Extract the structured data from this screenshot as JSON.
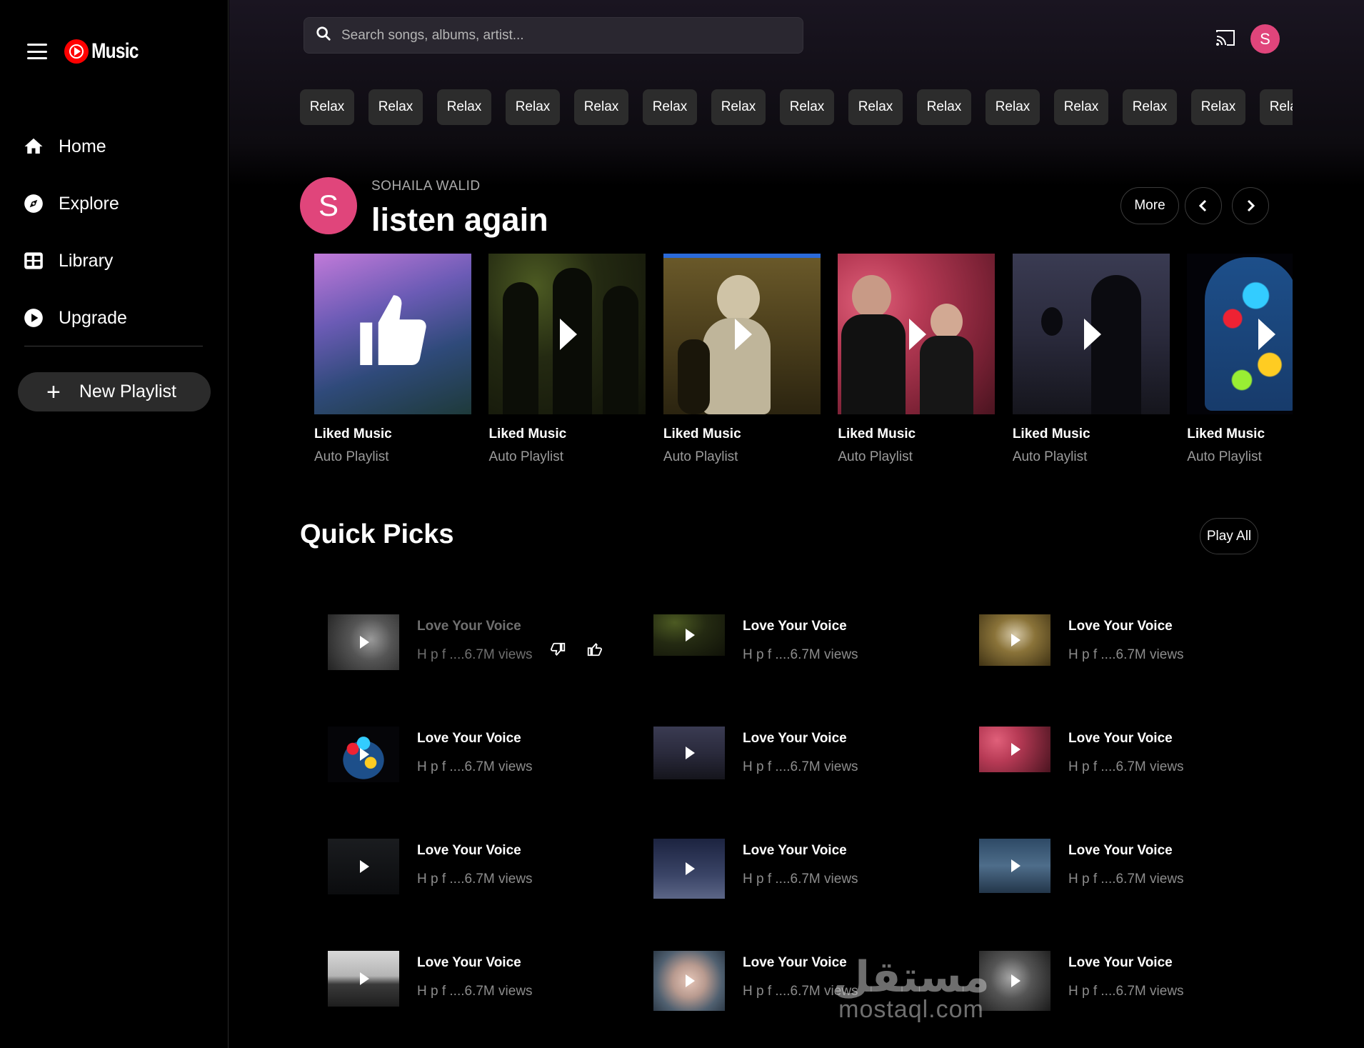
{
  "app": {
    "logo_text": "Music"
  },
  "sidebar": {
    "items": [
      {
        "label": "Home",
        "icon": "home-icon"
      },
      {
        "label": "Explore",
        "icon": "compass-icon"
      },
      {
        "label": "Library",
        "icon": "library-icon"
      },
      {
        "label": "Upgrade",
        "icon": "upgrade-icon"
      }
    ],
    "new_playlist_label": "New Playlist"
  },
  "search": {
    "placeholder": "Search songs, albums, artist..."
  },
  "header": {
    "avatar_letter": "S"
  },
  "chips": [
    "Relax",
    "Relax",
    "Relax",
    "Relax",
    "Relax",
    "Relax",
    "Relax",
    "Relax",
    "Relax",
    "Relax",
    "Relax",
    "Relax",
    "Relax",
    "Relax",
    "Relax"
  ],
  "listen_again": {
    "avatar_letter": "S",
    "user_name": "SOHAILA WALID",
    "title": "listen again",
    "more_label": "More",
    "cards": [
      {
        "title": "Liked Music",
        "subtitle": "Auto Playlist"
      },
      {
        "title": "Liked Music",
        "subtitle": "Auto Playlist"
      },
      {
        "title": "Liked Music",
        "subtitle": "Auto Playlist"
      },
      {
        "title": "Liked Music",
        "subtitle": "Auto Playlist"
      },
      {
        "title": "Liked Music",
        "subtitle": "Auto Playlist"
      },
      {
        "title": "Liked Music",
        "subtitle": "Auto Playlist"
      }
    ]
  },
  "quick_picks": {
    "title": "Quick Picks",
    "play_all_label": "Play All",
    "songs": [
      {
        "title": "Love Your Voice",
        "subtitle": "H p f ....6.7M views"
      },
      {
        "title": "Love Your Voice",
        "subtitle": "H p f ....6.7M views"
      },
      {
        "title": "Love Your Voice",
        "subtitle": "H p f ....6.7M views"
      },
      {
        "title": "Love Your Voice",
        "subtitle": "H p f ....6.7M views"
      },
      {
        "title": "Love Your Voice",
        "subtitle": "H p f ....6.7M views"
      },
      {
        "title": "Love Your Voice",
        "subtitle": "H p f ....6.7M views"
      },
      {
        "title": "Love Your Voice",
        "subtitle": "H p f ....6.7M views"
      },
      {
        "title": "Love Your Voice",
        "subtitle": "H p f ....6.7M views"
      },
      {
        "title": "Love Your Voice",
        "subtitle": "H p f ....6.7M views"
      },
      {
        "title": "Love Your Voice",
        "subtitle": "H p f ....6.7M views"
      },
      {
        "title": "Love Your Voice",
        "subtitle": "H p f ....6.7M views"
      },
      {
        "title": "Love Your Voice",
        "subtitle": "H p f ....6.7M views"
      }
    ]
  },
  "watermark": {
    "line1": "مستقل",
    "line2": "mostaql.com"
  },
  "colors": {
    "accent_avatar": "#e0457b",
    "brand_red": "#ff0000",
    "chip_bg": "#2c2c2c"
  }
}
